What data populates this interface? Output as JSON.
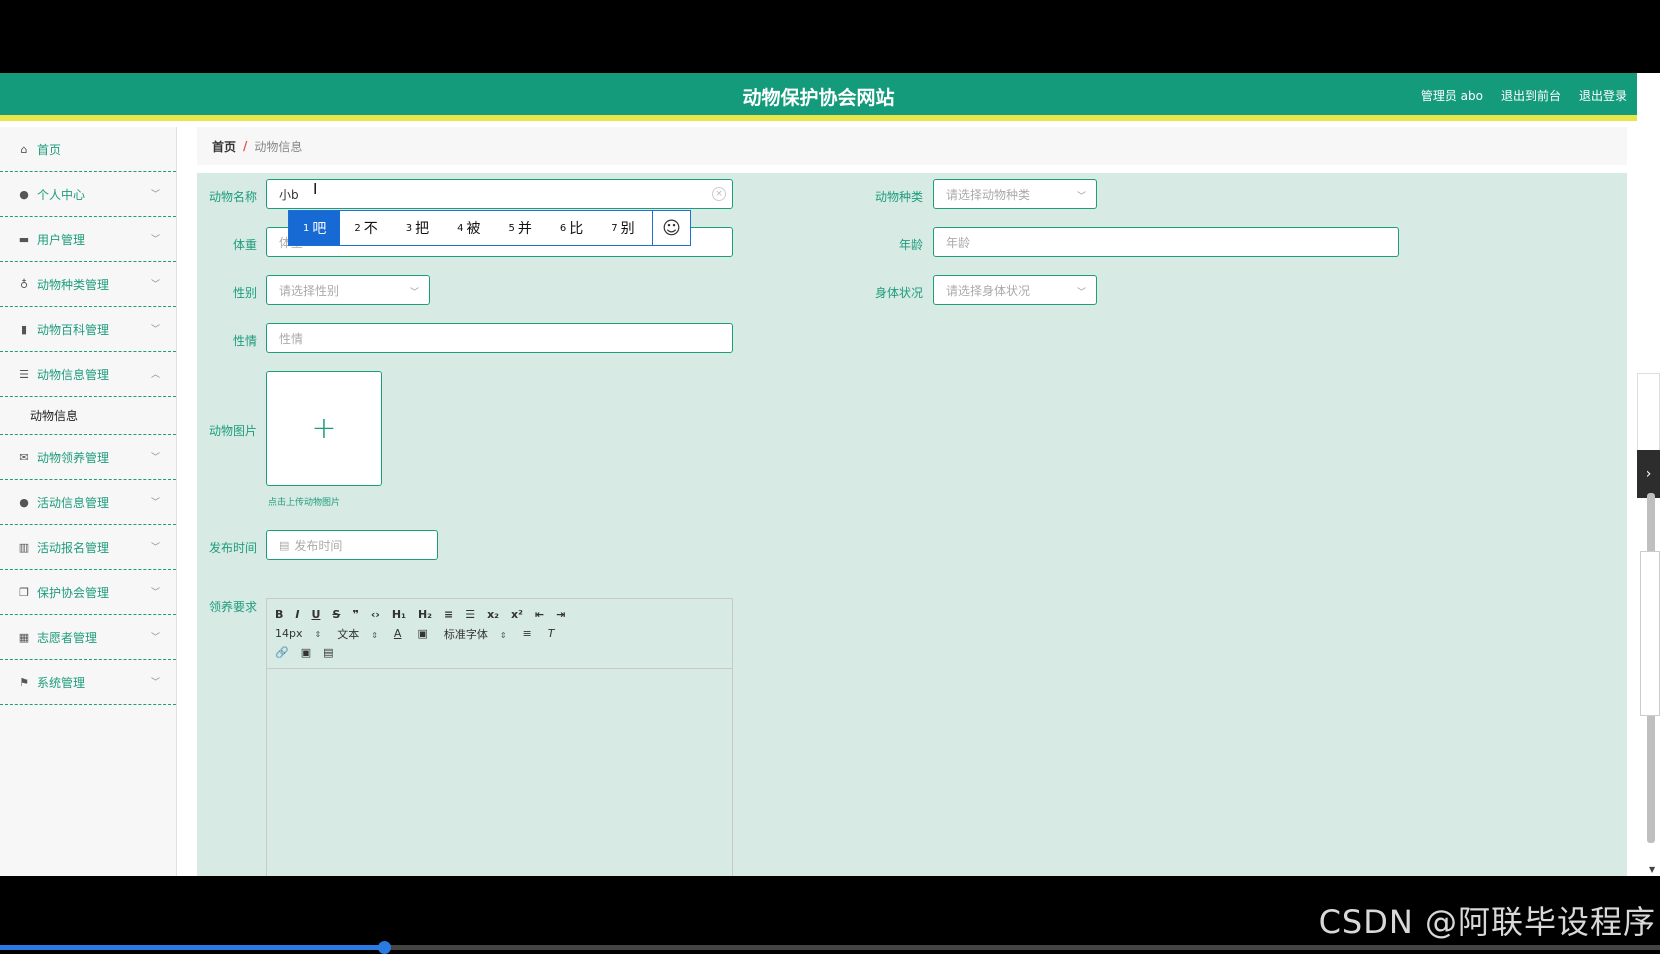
{
  "header": {
    "title": "动物保护协会网站",
    "admin_label": "管理员 abo",
    "back_front": "退出到前台",
    "logout": "退出登录"
  },
  "colors": {
    "brand": "#139b7b",
    "accent_strip": "#e8e54a",
    "form_bg": "#d7eae4",
    "ime_selected": "#1769d4"
  },
  "sidebar": {
    "items": [
      {
        "label": "首页",
        "icon": "home-icon"
      },
      {
        "label": "个人中心",
        "icon": "user-icon"
      },
      {
        "label": "用户管理",
        "icon": "users-icon"
      },
      {
        "label": "动物种类管理",
        "icon": "microphone-icon"
      },
      {
        "label": "动物百科管理",
        "icon": "clipboard-icon"
      },
      {
        "label": "动物信息管理",
        "icon": "sliders-icon",
        "expanded": true
      },
      {
        "label": "动物领养管理",
        "icon": "mail-icon"
      },
      {
        "label": "活动信息管理",
        "icon": "person-icon"
      },
      {
        "label": "活动报名管理",
        "icon": "bar-chart-icon"
      },
      {
        "label": "保护协会管理",
        "icon": "copy-icon"
      },
      {
        "label": "志愿者管理",
        "icon": "library-icon"
      },
      {
        "label": "系统管理",
        "icon": "flag-icon"
      }
    ],
    "sub_item": "动物信息"
  },
  "breadcrumb": {
    "home": "首页",
    "sep": "/",
    "current": "动物信息"
  },
  "form": {
    "name_label": "动物名称",
    "name_value": "小b",
    "type_label": "动物种类",
    "type_placeholder": "请选择动物种类",
    "weight_label": "体重",
    "weight_placeholder": "体重",
    "age_label": "年龄",
    "age_placeholder": "年龄",
    "gender_label": "性别",
    "gender_placeholder": "请选择性别",
    "health_label": "身体状况",
    "health_placeholder": "请选择身体状况",
    "temper_label": "性情",
    "temper_placeholder": "性情",
    "image_label": "动物图片",
    "upload_plus": "+",
    "upload_tip": "点击上传动物图片",
    "date_label": "发布时间",
    "date_placeholder": "发布时间",
    "requirement_label": "领养要求"
  },
  "editor": {
    "row1": [
      "B",
      "I",
      "U",
      "S",
      "❞",
      "‹›",
      "H₁",
      "H₂",
      "≡",
      "☰",
      "x₂",
      "x²",
      "⇤",
      "⇥"
    ],
    "size": "14px",
    "format": "文本",
    "font": "标准字体",
    "row3": [
      "🔗",
      "▣",
      "▤"
    ]
  },
  "ime": {
    "candidates": [
      {
        "num": "1",
        "char": "吧"
      },
      {
        "num": "2",
        "char": "不"
      },
      {
        "num": "3",
        "char": "把"
      },
      {
        "num": "4",
        "char": "被"
      },
      {
        "num": "5",
        "char": "并"
      },
      {
        "num": "6",
        "char": "比"
      },
      {
        "num": "7",
        "char": "别"
      }
    ],
    "emoji": "☺"
  },
  "watermark": "CSDN @阿联毕设程序"
}
